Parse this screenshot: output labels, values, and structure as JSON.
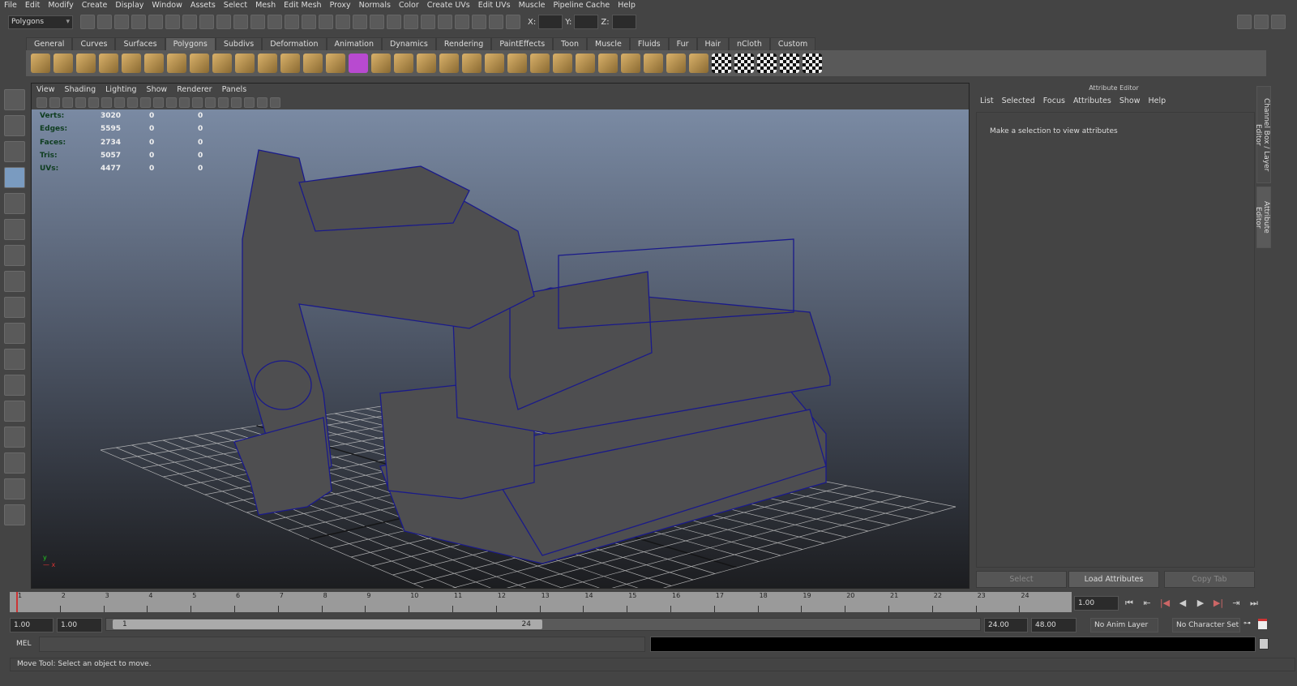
{
  "menubar": [
    "File",
    "Edit",
    "Modify",
    "Create",
    "Display",
    "Window",
    "Assets",
    "Select",
    "Mesh",
    "Edit Mesh",
    "Proxy",
    "Normals",
    "Color",
    "Create UVs",
    "Edit UVs",
    "Muscle",
    "Pipeline Cache",
    "Help"
  ],
  "statusline": {
    "mode": "Polygons",
    "x_label": "X:",
    "y_label": "Y:",
    "z_label": "Z:"
  },
  "shelf_tabs": [
    "General",
    "Curves",
    "Surfaces",
    "Polygons",
    "Subdivs",
    "Deformation",
    "Animation",
    "Dynamics",
    "Rendering",
    "PaintEffects",
    "Toon",
    "Muscle",
    "Fluids",
    "Fur",
    "Hair",
    "nCloth",
    "Custom"
  ],
  "active_shelf": "Polygons",
  "panel_menu": [
    "View",
    "Shading",
    "Lighting",
    "Show",
    "Renderer",
    "Panels"
  ],
  "hud": [
    {
      "label": "Verts:",
      "values": [
        "3020",
        "0",
        "0"
      ]
    },
    {
      "label": "Edges:",
      "values": [
        "5595",
        "0",
        "0"
      ]
    },
    {
      "label": "Faces:",
      "values": [
        "2734",
        "0",
        "0"
      ]
    },
    {
      "label": "Tris:",
      "values": [
        "5057",
        "0",
        "0"
      ]
    },
    {
      "label": "UVs:",
      "values": [
        "4477",
        "0",
        "0"
      ]
    }
  ],
  "attribute_editor": {
    "title": "Attribute Editor",
    "menu": [
      "List",
      "Selected",
      "Focus",
      "Attributes",
      "Show",
      "Help"
    ],
    "message": "Make a selection to view attributes",
    "buttons": [
      "Select",
      "Load Attributes",
      "Copy Tab"
    ]
  },
  "side_tabs": [
    "Channel Box / Layer Editor",
    "Attribute Editor"
  ],
  "timeline": {
    "ticks": [
      "1",
      "2",
      "3",
      "4",
      "5",
      "6",
      "7",
      "8",
      "9",
      "10",
      "11",
      "12",
      "13",
      "14",
      "15",
      "16",
      "17",
      "18",
      "19",
      "20",
      "21",
      "22",
      "23",
      "24"
    ],
    "current": "1.00"
  },
  "range": {
    "start": "1.00",
    "anim_start": "1.00",
    "slider_start": "1",
    "slider_end": "24",
    "end": "24.00",
    "anim_end": "48.00",
    "anim_layer": "No Anim Layer",
    "char_set": "No Character Set"
  },
  "mel": {
    "label": "MEL"
  },
  "help_line": "Move Tool: Select an object to move."
}
